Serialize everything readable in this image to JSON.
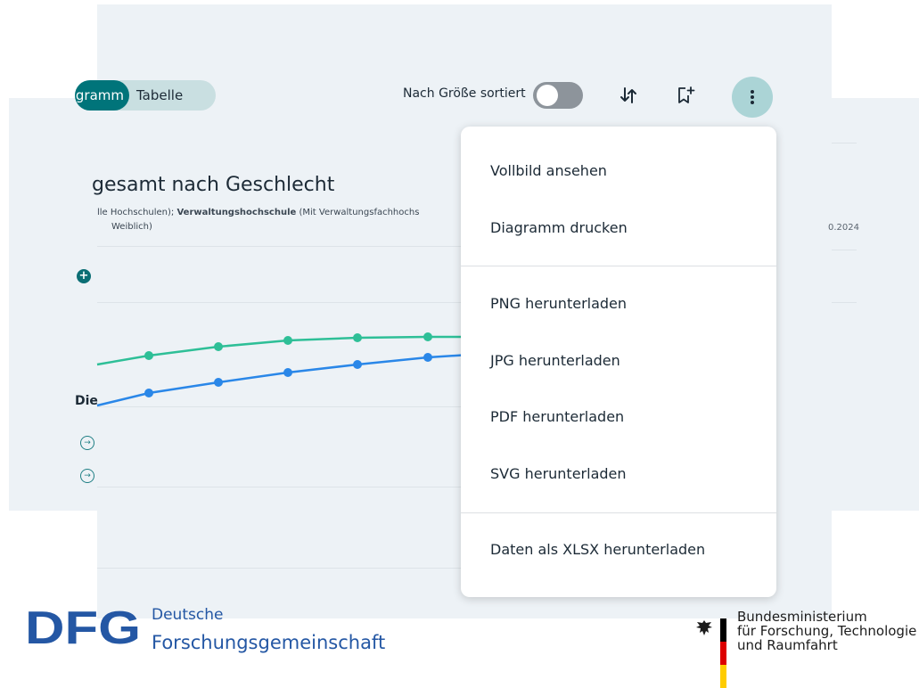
{
  "view_toggle": {
    "active_label": "gramm",
    "inactive_label": "Tabelle"
  },
  "sort": {
    "label": "Nach Größe sortiert",
    "enabled": false
  },
  "toolbar_icons": [
    "sort-icon",
    "bookmark-add-icon",
    "more-vertical-icon"
  ],
  "chart": {
    "title": "gesamt nach Geschlecht",
    "subtitle_prefix": "lle Hochschulen); ",
    "subtitle_bold": "Verwaltungshochschule",
    "subtitle_suffix": " (Mit Verwaltungsfachhochs",
    "subtitle_line2": "Weiblich)",
    "date_fragment": "0.2024",
    "legend_heading": "Die"
  },
  "chart_data": {
    "type": "line",
    "title": "",
    "xlabel": "",
    "ylabel": "",
    "series": [
      {
        "name": "",
        "color": "#2ebf97",
        "values": [
          null,
          399,
          389,
          382,
          379,
          378,
          378
        ]
      },
      {
        "name": "",
        "color": "#2a87e8",
        "values": [
          null,
          441,
          429,
          418,
          409,
          401,
          396
        ]
      }
    ]
  },
  "menu": {
    "sections": [
      [
        "Vollbild ansehen",
        "Diagramm drucken"
      ],
      [
        "PNG herunterladen",
        "JPG herunterladen",
        "PDF herunterladen",
        "SVG herunterladen"
      ],
      [
        "Daten als XLSX herunterladen"
      ]
    ]
  },
  "footer": {
    "dfg_mark": "DFG",
    "dfg_line1": "Deutsche",
    "dfg_line2": "Forschungsgemeinschaft",
    "bmbf_line1": "Bundesministerium",
    "bmbf_line2": "für Forschung, Technologie",
    "bmbf_line3": "und Raumfahrt",
    "flag_colors": [
      "#000000",
      "#dd0000",
      "#ffcc00"
    ]
  }
}
